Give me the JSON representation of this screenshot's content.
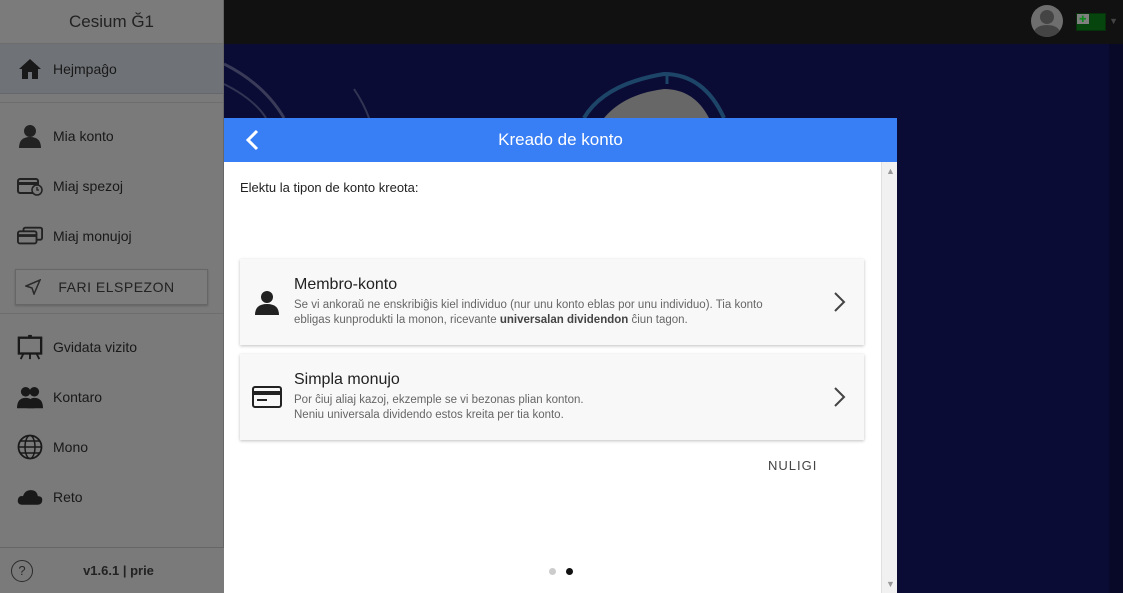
{
  "sidebar": {
    "app_title": "Cesium Ğ1",
    "items": [
      {
        "label": "Hejmpaĝo",
        "icon": "home-icon",
        "active": true
      },
      {
        "label": "Mia konto",
        "icon": "user-icon"
      },
      {
        "label": "Miaj spezoj",
        "icon": "wallet-history-icon"
      },
      {
        "label": "Miaj monujoj",
        "icon": "wallets-icon"
      }
    ],
    "send_button": "FARI ELSPEZON",
    "items2": [
      {
        "label": "Gvidata vizito",
        "icon": "easel-icon"
      },
      {
        "label": "Kontaro",
        "icon": "people-icon"
      },
      {
        "label": "Mono",
        "icon": "globe-icon"
      },
      {
        "label": "Reto",
        "icon": "cloud-icon"
      }
    ],
    "footer": {
      "help": "?",
      "version": "v1.6.1 | prie"
    }
  },
  "topbar": {
    "avatar": "avatar-icon",
    "language": "esperanto-flag-icon"
  },
  "modal": {
    "title": "Kreado de konto",
    "intro": "Elektu la tipon de konto kreota:",
    "cards": [
      {
        "title": "Membro-konto",
        "desc_line1": "Se vi ankoraŭ ne enskribiĝis kiel individuo (nur unu konto eblas por unu individuo). Tia konto",
        "desc_line2_pre": "ebligas kunprodukti la monon, ricevante ",
        "desc_line2_bold": "universalan dividendon",
        "desc_line2_post": " ĉiun tagon.",
        "icon": "person-icon"
      },
      {
        "title": "Simpla monujo",
        "desc_line1": "Por ĉiuj aliaj kazoj, ekzemple se vi bezonas plian konton.",
        "desc_line2": "Neniu universala dividendo estos kreita per tia konto.",
        "icon": "card-icon"
      }
    ],
    "cancel": "NULIGI",
    "pager": {
      "count": 2,
      "active": 2
    }
  },
  "colors": {
    "header": "#387ef5",
    "hero": "#16186a"
  }
}
